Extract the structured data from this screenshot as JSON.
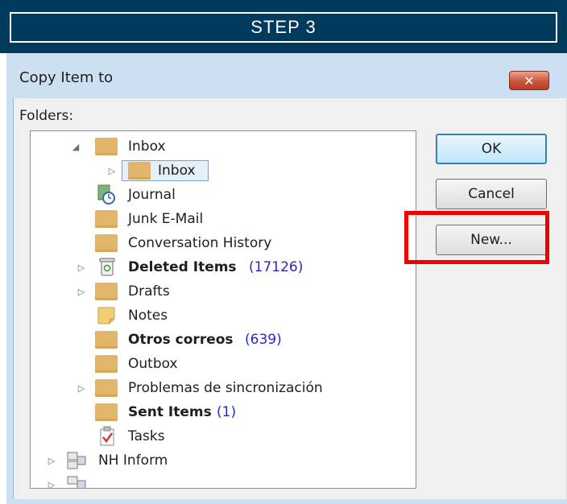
{
  "banner": {
    "text": "STEP 3"
  },
  "dialog": {
    "title": "Copy Item to",
    "close_symbol": "✕",
    "folders_label": "Folders:",
    "buttons": {
      "ok": "OK",
      "cancel": "Cancel",
      "new": "New..."
    },
    "tree": [
      {
        "label": "Inbox",
        "icon": "folder-icon",
        "expander": "expanded"
      },
      {
        "label": "Inbox",
        "icon": "folder-icon",
        "expander": "collapsed",
        "selected": true
      },
      {
        "label": "Journal",
        "icon": "journal-icon"
      },
      {
        "label": "Junk E-Mail",
        "icon": "folder-icon"
      },
      {
        "label": "Conversation History",
        "icon": "folder-icon"
      },
      {
        "label": "Deleted Items",
        "count": "(17126)",
        "icon": "trash-icon",
        "bold": true,
        "expander": "collapsed"
      },
      {
        "label": "Drafts",
        "icon": "folder-icon",
        "expander": "collapsed"
      },
      {
        "label": "Notes",
        "icon": "notes-icon"
      },
      {
        "label": "Otros correos",
        "count": "(639)",
        "icon": "folder-icon",
        "bold": true
      },
      {
        "label": "Outbox",
        "icon": "folder-icon"
      },
      {
        "label": "Problemas de sincronización",
        "icon": "folder-icon",
        "expander": "collapsed"
      },
      {
        "label": "Sent Items",
        "count": "(1)",
        "icon": "folder-icon",
        "bold": true
      },
      {
        "label": "Tasks",
        "icon": "tasks-icon"
      },
      {
        "label": "NH Inform",
        "icon": "mailbox-icon",
        "expander": "collapsed"
      }
    ]
  },
  "colors": {
    "banner": "#003a5d",
    "highlight": "#f20000",
    "count": "#2626cc",
    "folder": "#e2b66a"
  }
}
